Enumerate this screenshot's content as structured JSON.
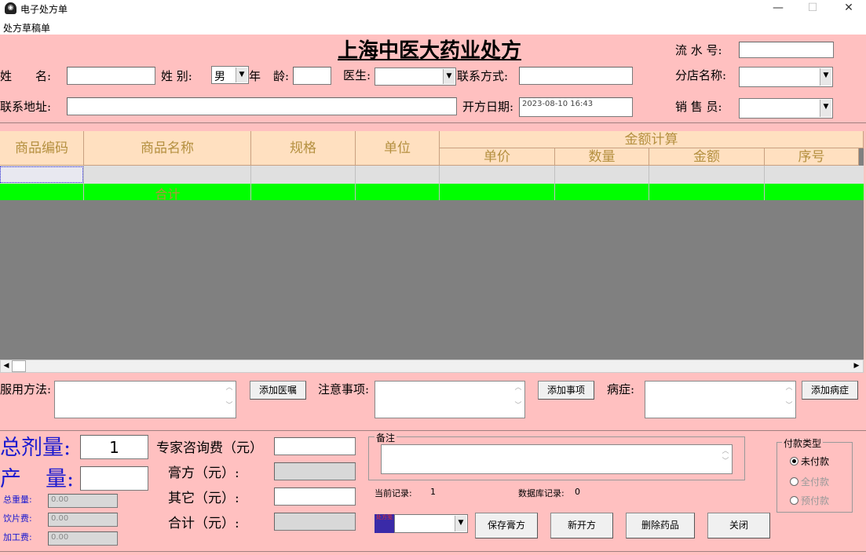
{
  "window": {
    "title": "电子处方单",
    "icon": "pestle-icon",
    "minimize": "—",
    "maximize": "☐",
    "close": "✕"
  },
  "menu": {
    "item": "处方草稿单"
  },
  "form": {
    "title": "上海中医大药业处方",
    "serial_label": "流 水 号:",
    "serial_value": "",
    "name_label_1": "姓",
    "name_label_2": "名:",
    "name_value": "",
    "gender_label": "姓  别:",
    "gender_value": "男",
    "age_label_1": "年",
    "age_label_2": "龄:",
    "age_value": "",
    "doctor_label": "医生:",
    "doctor_value": "",
    "contact_label": "联系方式:",
    "contact_value": "",
    "branch_label": "分店名称:",
    "branch_value": "",
    "address_label": "联系地址:",
    "address_value": "",
    "date_label": "开方日期:",
    "date_value": "2023-08-10 16:43",
    "seller_label": "销 售 员:",
    "seller_value": ""
  },
  "grid": {
    "headers": {
      "code": "商品编码",
      "name": "商品名称",
      "spec": "规格",
      "unit": "单位",
      "amount_group": "金额计算",
      "price": "单价",
      "qty": "数量",
      "amount": "金额",
      "seq": "序号"
    },
    "total_label": "合计"
  },
  "usage": {
    "label": "服用方法:",
    "button": "添加医嘱",
    "value": ""
  },
  "notes": {
    "label": "注意事项:",
    "button": "添加事项",
    "value": ""
  },
  "disease": {
    "label": "病症:",
    "button": "添加病症",
    "value": ""
  },
  "dosage": {
    "total_label": "总剂量:",
    "total_value": "1",
    "output_label_1": "产",
    "output_label_2": "量:",
    "output_value": ""
  },
  "small": {
    "weight_label": "总重量:",
    "weight_value": "0.00",
    "slice_label": "饮片费:",
    "slice_value": "0.00",
    "process_label": "加工费:",
    "process_value": "0.00"
  },
  "fees": {
    "expert_label": "专家咨询费（元）",
    "expert_value": "",
    "paste_label": "膏方（元）:",
    "paste_value": "",
    "other_label": "其它（元）:",
    "other_value": "",
    "total_label": "合计（元）:",
    "total_value": ""
  },
  "remark": {
    "label": "备注",
    "value": ""
  },
  "records": {
    "current_label": "当前记录:",
    "current_value": "1",
    "db_label": "数据库记录:",
    "db_value": "0"
  },
  "chip": {
    "text": "处方笺"
  },
  "buttons": {
    "save_paste": "保存膏方",
    "new": "新开方",
    "delete": "删除药品",
    "close": "关闭"
  },
  "payment": {
    "title": "付款类型",
    "options": [
      "未付款",
      "全付款",
      "预付款"
    ],
    "selected": 0
  },
  "colors": {
    "background": "#ffc0c0",
    "grid": "#808080",
    "total_row": "#00ff00",
    "header": "#ffe0c0",
    "accent": "#1a1ad0"
  }
}
